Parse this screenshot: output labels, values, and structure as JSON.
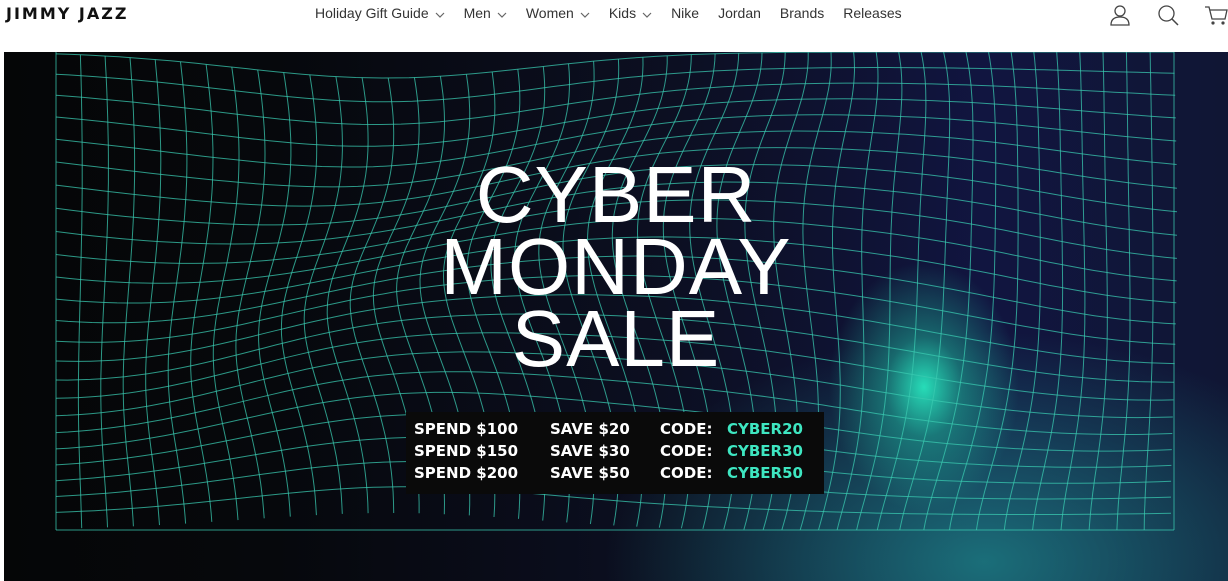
{
  "header": {
    "logo": "JIMMY JAZZ",
    "nav": [
      {
        "label": "Holiday Gift Guide",
        "has_dropdown": true
      },
      {
        "label": "Men",
        "has_dropdown": true
      },
      {
        "label": "Women",
        "has_dropdown": true
      },
      {
        "label": "Kids",
        "has_dropdown": true
      },
      {
        "label": "Nike",
        "has_dropdown": false
      },
      {
        "label": "Jordan",
        "has_dropdown": false
      },
      {
        "label": "Brands",
        "has_dropdown": false
      },
      {
        "label": "Releases",
        "has_dropdown": false
      }
    ],
    "icons": [
      "user-icon",
      "search-icon",
      "cart-icon"
    ]
  },
  "hero": {
    "title_lines": [
      "CYBER",
      "MONDAY",
      "SALE"
    ],
    "promos": [
      {
        "spend": "SPEND $100",
        "save": "SAVE $20",
        "code_label": "CODE:",
        "code": "CYBER20"
      },
      {
        "spend": "SPEND $150",
        "save": "SAVE $30",
        "code_label": "CODE:",
        "code": "CYBER30"
      },
      {
        "spend": "SPEND $200",
        "save": "SAVE $50",
        "code_label": "CODE:",
        "code": "CYBER50"
      }
    ]
  },
  "colors": {
    "accent": "#3ee6c1",
    "grid": "#39c9b0",
    "text": "#333333"
  }
}
